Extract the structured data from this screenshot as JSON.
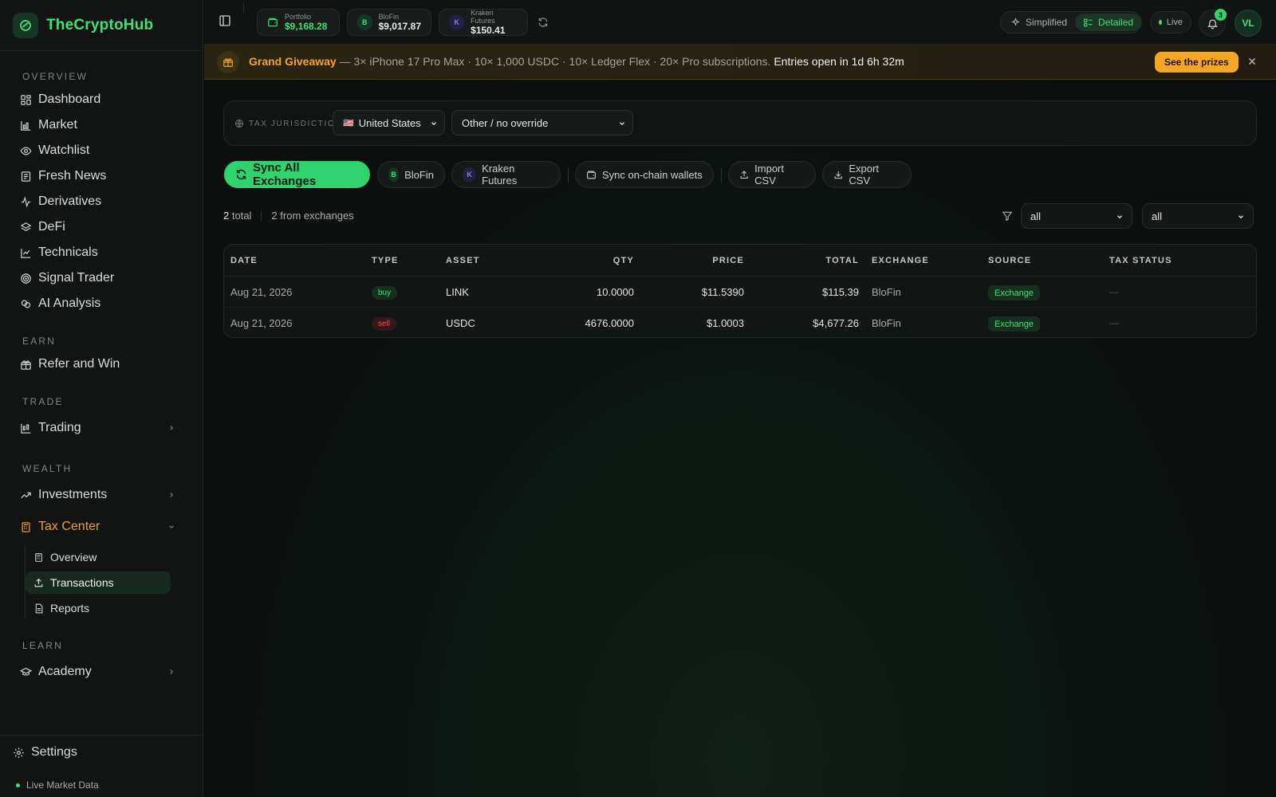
{
  "brand": {
    "name": "TheCryptoHub"
  },
  "sidebar": {
    "sections": {
      "overview": "OVERVIEW",
      "earn": "EARN",
      "trade": "TRADE",
      "wealth": "WEALTH",
      "learn": "LEARN"
    },
    "overview_items": [
      {
        "label": "Dashboard",
        "icon": "dashboard-icon"
      },
      {
        "label": "Market",
        "icon": "market-icon"
      },
      {
        "label": "Watchlist",
        "icon": "eye-icon"
      },
      {
        "label": "Fresh News",
        "icon": "newspaper-icon"
      },
      {
        "label": "Derivatives",
        "icon": "activity-icon"
      },
      {
        "label": "DeFi",
        "icon": "layers-icon"
      },
      {
        "label": "Technicals",
        "icon": "line-chart-icon"
      },
      {
        "label": "Signal Trader",
        "icon": "target-icon"
      },
      {
        "label": "AI Analysis",
        "icon": "brain-icon"
      }
    ],
    "earn_item": "Refer and Win",
    "trade_item": "Trading",
    "wealth_items": {
      "investments": "Investments",
      "tax_center": "Tax Center"
    },
    "tax_sub": [
      "Overview",
      "Transactions",
      "Reports"
    ],
    "learn_item": "Academy",
    "settings": "Settings",
    "live_data": "Live Market Data"
  },
  "topbar": {
    "portfolio_label": "Portfolio",
    "portfolio_value": "$9,168.28",
    "blofin_label": "BloFin",
    "blofin_value": "$9,017.87",
    "blofin_initial": "B",
    "kraken_label": "Kraken Futures",
    "kraken_value": "$150.41",
    "kraken_initial": "K",
    "mode_simplified": "Simplified",
    "mode_detailed": "Detailed",
    "live": "Live",
    "notif_count": "3",
    "avatar": "VL"
  },
  "banner": {
    "title": "Grand Giveaway",
    "body": " — 3× iPhone 17 Pro Max · 10× 1,000 USDC · 10× Ledger Flex · 20× Pro subscriptions. ",
    "countdown": "Entries open in 1d 6h 32m",
    "cta": "See the prizes"
  },
  "jurisdiction": {
    "label": "TAX JURISDICTION",
    "flag": "🇺🇸",
    "country": "United States",
    "override": "Other / no override"
  },
  "actions": {
    "sync_all": "Sync All Exchanges",
    "blofin": "BloFin",
    "blofin_initial": "B",
    "kraken": "Kraken Futures",
    "kraken_initial": "K",
    "sync_wallets": "Sync on-chain wallets",
    "import_csv": "Import CSV",
    "export_csv": "Export CSV"
  },
  "summary": {
    "total_count": "2",
    "total_label": "total",
    "from_exchanges": "2 from exchanges"
  },
  "filters": {
    "type": "all",
    "source": "all"
  },
  "table": {
    "columns": [
      "DATE",
      "TYPE",
      "ASSET",
      "QTY",
      "PRICE",
      "TOTAL",
      "EXCHANGE",
      "SOURCE",
      "TAX STATUS"
    ],
    "rows": [
      {
        "date": "Aug 21, 2026",
        "type": "buy",
        "asset": "LINK",
        "qty": "10.0000",
        "price": "$11.5390",
        "total": "$115.39",
        "exchange": "BloFin",
        "source": "Exchange",
        "tax_status": "—"
      },
      {
        "date": "Aug 21, 2026",
        "type": "sell",
        "asset": "USDC",
        "qty": "4676.0000",
        "price": "$1.0003",
        "total": "$4,677.26",
        "exchange": "BloFin",
        "source": "Exchange",
        "tax_status": "—"
      }
    ]
  },
  "colors": {
    "accent_green": "#3ee07a",
    "accent_orange": "#f5a623",
    "sell_red": "#ef5350",
    "background": "#0c0f0e"
  }
}
